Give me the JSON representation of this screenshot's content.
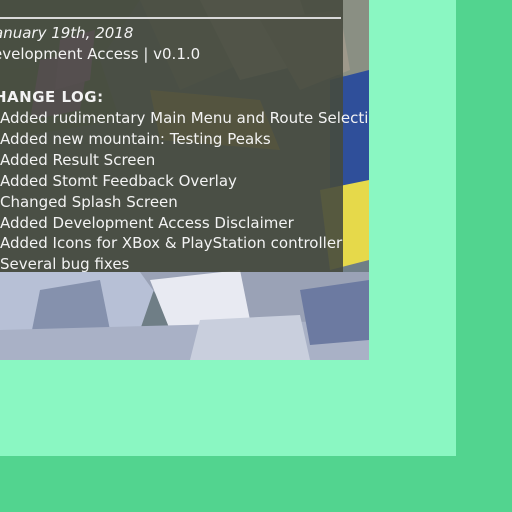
{
  "panel": {
    "date": "anuary 19th, 2018",
    "version": "evelopment Access | v0.1.0",
    "heading": "HANGE LOG:",
    "items": [
      "Added rudimentary Main Menu and Route Selection",
      "Added new mountain: Testing Peaks",
      "Added Result Screen",
      "Added Stomt Feedback Overlay",
      "Changed Splash Screen",
      "Added Development Access Disclaimer",
      "Added Icons for XBox & PlayStation controller",
      "Several bug fixes"
    ]
  },
  "colors": {
    "outer_bg": "#52d48f",
    "frame_bg": "#8af7c2",
    "panel_bg": "#464a3e",
    "panel_text": "#f3f3f3"
  }
}
